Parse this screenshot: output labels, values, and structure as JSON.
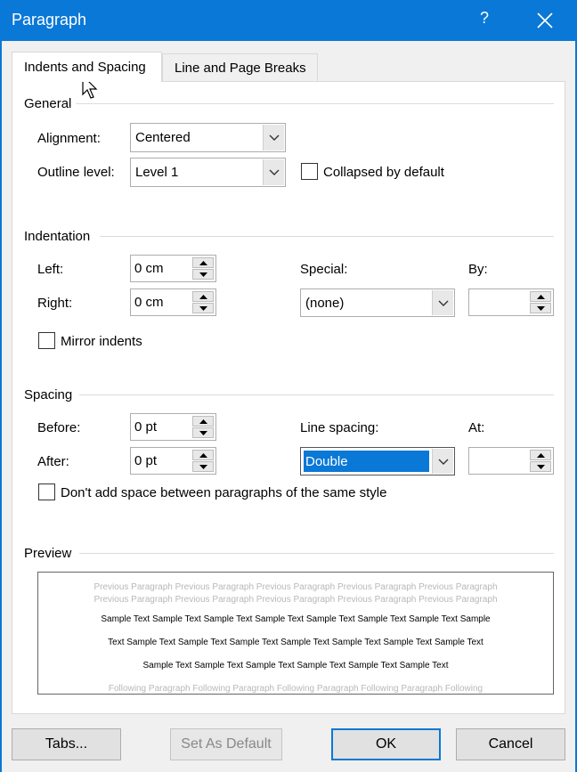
{
  "window": {
    "title": "Paragraph",
    "help": "?"
  },
  "tabs": [
    {
      "label": "Indents and Spacing",
      "active": true
    },
    {
      "label": "Line and Page Breaks",
      "active": false
    }
  ],
  "general": {
    "title": "General",
    "alignment_label": "Alignment:",
    "alignment_value": "Centered",
    "outline_label": "Outline level:",
    "outline_value": "Level 1",
    "collapsed_label": "Collapsed by default"
  },
  "indentation": {
    "title": "Indentation",
    "left_label": "Left:",
    "left_value": "0 cm",
    "right_label": "Right:",
    "right_value": "0 cm",
    "special_label": "Special:",
    "special_value": "(none)",
    "by_label": "By:",
    "by_value": "",
    "mirror_label": "Mirror indents"
  },
  "spacing": {
    "title": "Spacing",
    "before_label": "Before:",
    "before_value": "0 pt",
    "after_label": "After:",
    "after_value": "0 pt",
    "line_spacing_label": "Line spacing:",
    "line_spacing_value": "Double",
    "at_label": "At:",
    "at_value": "",
    "dont_add_label": "Don't add space between paragraphs of the same style"
  },
  "preview": {
    "title": "Preview",
    "prev1": "Previous Paragraph Previous Paragraph Previous Paragraph Previous Paragraph Previous Paragraph",
    "prev2": "Previous Paragraph Previous Paragraph Previous Paragraph Previous Paragraph Previous Paragraph",
    "sample1": "Sample Text Sample Text Sample Text Sample Text Sample Text Sample Text Sample Text Sample",
    "sample2": "Text Sample Text Sample Text Sample Text Sample Text Sample Text Sample Text Sample Text",
    "sample3": "Sample Text Sample Text Sample Text Sample Text Sample Text Sample Text",
    "following": "Following Paragraph Following Paragraph Following Paragraph Following Paragraph Following"
  },
  "buttons": {
    "tabs": "Tabs...",
    "set_default": "Set As Default",
    "ok": "OK",
    "cancel": "Cancel"
  },
  "colors": {
    "accent": "#0a78d6"
  }
}
